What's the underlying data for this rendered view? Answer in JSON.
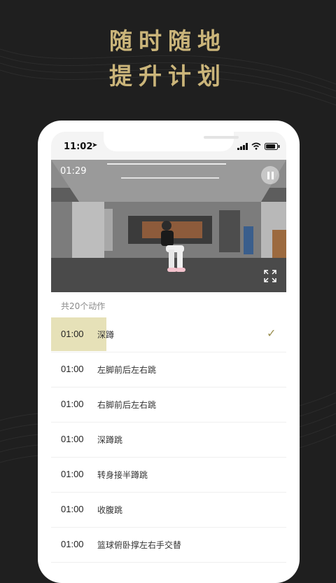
{
  "promo": {
    "line1": "随时随地",
    "line2": "提升计划"
  },
  "status_bar": {
    "time": "11:02",
    "location_icon": "location-arrow-icon"
  },
  "video": {
    "elapsed": "01:29",
    "state": "playing"
  },
  "list": {
    "count_label": "共20个动作",
    "items": [
      {
        "duration": "01:00",
        "name": "深蹲",
        "active": true,
        "done": true
      },
      {
        "duration": "01:00",
        "name": "左脚前后左右跳"
      },
      {
        "duration": "01:00",
        "name": "右脚前后左右跳"
      },
      {
        "duration": "01:00",
        "name": "深蹲跳"
      },
      {
        "duration": "01:00",
        "name": "转身接半蹲跳"
      },
      {
        "duration": "01:00",
        "name": "收腹跳"
      },
      {
        "duration": "01:00",
        "name": "篮球俯卧撑左右手交替"
      }
    ]
  },
  "colors": {
    "accent": "#cbb57a",
    "highlight": "#e6e1b8",
    "check": "#9a8f50"
  }
}
